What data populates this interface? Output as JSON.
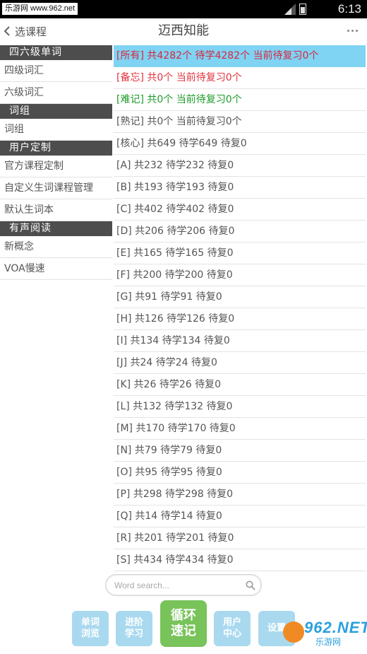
{
  "status": {
    "watermark": "乐游网 www.962.net",
    "time": "6:13"
  },
  "header": {
    "back_label": "选课程",
    "title": "迈西知能"
  },
  "sidebar": {
    "groups": [
      {
        "category": "四六级单词",
        "items": [
          "四级词汇",
          "六级词汇"
        ]
      },
      {
        "category": "词组",
        "items": [
          "词组"
        ]
      },
      {
        "category": "用户定制",
        "items": [
          "官方课程定制",
          "自定义生词课程管理",
          "默认生词本"
        ]
      },
      {
        "category": "有声阅读",
        "items": [
          "新概念",
          "VOA慢速"
        ]
      }
    ]
  },
  "list": {
    "rows": [
      "[所有] 共4282个 待学4282个 当前待复习0个",
      "[备忘] 共0个 当前待复习0个",
      "[难记] 共0个 当前待复习0个",
      "[熟记] 共0个 当前待复习0个",
      "[核心] 共649 待学649 待复0",
      "[A] 共232 待学232 待复0",
      "[B] 共193 待学193 待复0",
      "[C] 共402 待学402 待复0",
      "[D] 共206 待学206 待复0",
      "[E] 共165 待学165 待复0",
      "[F] 共200 待学200 待复0",
      "[G] 共91 待学91 待复0",
      "[H] 共126 待学126 待复0",
      "[I] 共134 待学134 待复0",
      "[J] 共24 待学24 待复0",
      "[K] 共26 待学26 待复0",
      "[L] 共132 待学132 待复0",
      "[M] 共170 待学170 待复0",
      "[N] 共79 待学79 待复0",
      "[O] 共95 待学95 待复0",
      "[P] 共298 待学298 待复0",
      "[Q] 共14 待学14 待复0",
      "[R] 共201 待学201 待复0",
      "[S] 共434 待学434 待复0"
    ],
    "row_colors": {
      "selected_bg": "#7fd3f3",
      "all": "#d7263d",
      "memo": "#e0343f",
      "hard": "#1d9b2a",
      "normal": "#555555"
    }
  },
  "search": {
    "placeholder": "Word search...",
    "icon": "magnifier-icon"
  },
  "bottom": {
    "browse": "单词浏览",
    "advanced": "进阶学习",
    "loop": "循环速记",
    "user_center": "用户中心",
    "settings": "设置"
  },
  "watermark_logo": {
    "number": "962.NET",
    "text": "乐游网"
  }
}
